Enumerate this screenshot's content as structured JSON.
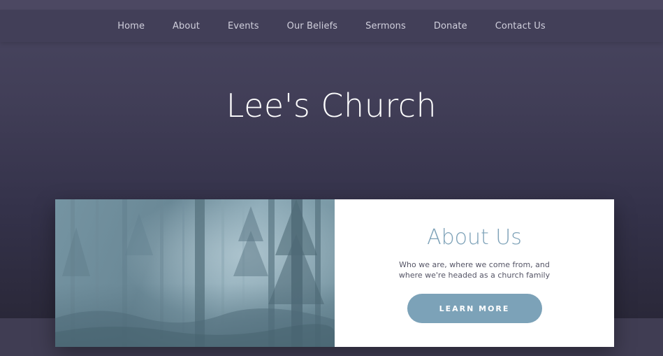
{
  "nav": {
    "items": [
      {
        "label": "Home"
      },
      {
        "label": "About"
      },
      {
        "label": "Events"
      },
      {
        "label": "Our Beliefs"
      },
      {
        "label": "Sermons"
      },
      {
        "label": "Donate"
      },
      {
        "label": "Contact Us"
      }
    ]
  },
  "hero": {
    "title": "Lee's Church"
  },
  "about": {
    "title": "About Us",
    "description": "Who we are, where we come from, and where we're headed as a church family",
    "button_label": "LEARN MORE",
    "image_name": "misty-forest-image"
  },
  "colors": {
    "hero_background": "#413e57",
    "nav_background": "#423f58",
    "accent": "#7ca2b8",
    "card_background": "#ffffff"
  }
}
